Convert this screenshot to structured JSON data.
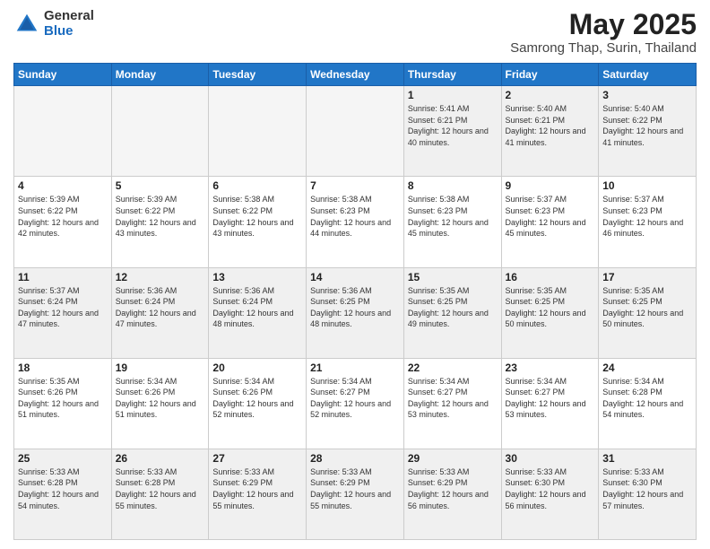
{
  "logo": {
    "general": "General",
    "blue": "Blue"
  },
  "header": {
    "month": "May 2025",
    "location": "Samrong Thap, Surin, Thailand"
  },
  "weekdays": [
    "Sunday",
    "Monday",
    "Tuesday",
    "Wednesday",
    "Thursday",
    "Friday",
    "Saturday"
  ],
  "weeks": [
    [
      {
        "day": "",
        "empty": true
      },
      {
        "day": "",
        "empty": true
      },
      {
        "day": "",
        "empty": true
      },
      {
        "day": "",
        "empty": true
      },
      {
        "day": "1",
        "sunrise": "5:41 AM",
        "sunset": "6:21 PM",
        "daylight": "12 hours and 40 minutes."
      },
      {
        "day": "2",
        "sunrise": "5:40 AM",
        "sunset": "6:21 PM",
        "daylight": "12 hours and 41 minutes."
      },
      {
        "day": "3",
        "sunrise": "5:40 AM",
        "sunset": "6:22 PM",
        "daylight": "12 hours and 41 minutes."
      }
    ],
    [
      {
        "day": "4",
        "sunrise": "5:39 AM",
        "sunset": "6:22 PM",
        "daylight": "12 hours and 42 minutes."
      },
      {
        "day": "5",
        "sunrise": "5:39 AM",
        "sunset": "6:22 PM",
        "daylight": "12 hours and 43 minutes."
      },
      {
        "day": "6",
        "sunrise": "5:38 AM",
        "sunset": "6:22 PM",
        "daylight": "12 hours and 43 minutes."
      },
      {
        "day": "7",
        "sunrise": "5:38 AM",
        "sunset": "6:23 PM",
        "daylight": "12 hours and 44 minutes."
      },
      {
        "day": "8",
        "sunrise": "5:38 AM",
        "sunset": "6:23 PM",
        "daylight": "12 hours and 45 minutes."
      },
      {
        "day": "9",
        "sunrise": "5:37 AM",
        "sunset": "6:23 PM",
        "daylight": "12 hours and 45 minutes."
      },
      {
        "day": "10",
        "sunrise": "5:37 AM",
        "sunset": "6:23 PM",
        "daylight": "12 hours and 46 minutes."
      }
    ],
    [
      {
        "day": "11",
        "sunrise": "5:37 AM",
        "sunset": "6:24 PM",
        "daylight": "12 hours and 47 minutes."
      },
      {
        "day": "12",
        "sunrise": "5:36 AM",
        "sunset": "6:24 PM",
        "daylight": "12 hours and 47 minutes."
      },
      {
        "day": "13",
        "sunrise": "5:36 AM",
        "sunset": "6:24 PM",
        "daylight": "12 hours and 48 minutes."
      },
      {
        "day": "14",
        "sunrise": "5:36 AM",
        "sunset": "6:25 PM",
        "daylight": "12 hours and 48 minutes."
      },
      {
        "day": "15",
        "sunrise": "5:35 AM",
        "sunset": "6:25 PM",
        "daylight": "12 hours and 49 minutes."
      },
      {
        "day": "16",
        "sunrise": "5:35 AM",
        "sunset": "6:25 PM",
        "daylight": "12 hours and 50 minutes."
      },
      {
        "day": "17",
        "sunrise": "5:35 AM",
        "sunset": "6:25 PM",
        "daylight": "12 hours and 50 minutes."
      }
    ],
    [
      {
        "day": "18",
        "sunrise": "5:35 AM",
        "sunset": "6:26 PM",
        "daylight": "12 hours and 51 minutes."
      },
      {
        "day": "19",
        "sunrise": "5:34 AM",
        "sunset": "6:26 PM",
        "daylight": "12 hours and 51 minutes."
      },
      {
        "day": "20",
        "sunrise": "5:34 AM",
        "sunset": "6:26 PM",
        "daylight": "12 hours and 52 minutes."
      },
      {
        "day": "21",
        "sunrise": "5:34 AM",
        "sunset": "6:27 PM",
        "daylight": "12 hours and 52 minutes."
      },
      {
        "day": "22",
        "sunrise": "5:34 AM",
        "sunset": "6:27 PM",
        "daylight": "12 hours and 53 minutes."
      },
      {
        "day": "23",
        "sunrise": "5:34 AM",
        "sunset": "6:27 PM",
        "daylight": "12 hours and 53 minutes."
      },
      {
        "day": "24",
        "sunrise": "5:34 AM",
        "sunset": "6:28 PM",
        "daylight": "12 hours and 54 minutes."
      }
    ],
    [
      {
        "day": "25",
        "sunrise": "5:33 AM",
        "sunset": "6:28 PM",
        "daylight": "12 hours and 54 minutes."
      },
      {
        "day": "26",
        "sunrise": "5:33 AM",
        "sunset": "6:28 PM",
        "daylight": "12 hours and 55 minutes."
      },
      {
        "day": "27",
        "sunrise": "5:33 AM",
        "sunset": "6:29 PM",
        "daylight": "12 hours and 55 minutes."
      },
      {
        "day": "28",
        "sunrise": "5:33 AM",
        "sunset": "6:29 PM",
        "daylight": "12 hours and 55 minutes."
      },
      {
        "day": "29",
        "sunrise": "5:33 AM",
        "sunset": "6:29 PM",
        "daylight": "12 hours and 56 minutes."
      },
      {
        "day": "30",
        "sunrise": "5:33 AM",
        "sunset": "6:30 PM",
        "daylight": "12 hours and 56 minutes."
      },
      {
        "day": "31",
        "sunrise": "5:33 AM",
        "sunset": "6:30 PM",
        "daylight": "12 hours and 57 minutes."
      }
    ]
  ],
  "labels": {
    "sunrise": "Sunrise:",
    "sunset": "Sunset:",
    "daylight": "Daylight:"
  }
}
